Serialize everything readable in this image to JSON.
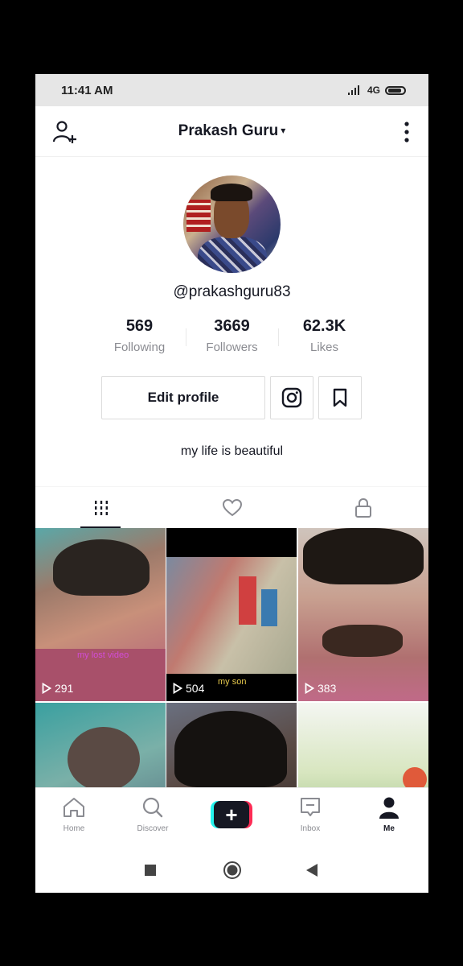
{
  "status_bar": {
    "time": "11:41 AM",
    "network": "4G"
  },
  "header": {
    "title": "Prakash Guru",
    "dropdown_caret": "▾"
  },
  "profile": {
    "username": "@prakashguru83",
    "stats": [
      {
        "value": "569",
        "label": "Following"
      },
      {
        "value": "3669",
        "label": "Followers"
      },
      {
        "value": "62.3K",
        "label": "Likes"
      }
    ],
    "edit_label": "Edit profile",
    "bio": "my life is beautiful"
  },
  "videos": [
    {
      "views": "291",
      "caption": "my lost video"
    },
    {
      "views": "504",
      "caption": "my son"
    },
    {
      "views": "383",
      "caption": ""
    },
    {
      "views": "",
      "caption": ""
    },
    {
      "views": "",
      "caption": ""
    },
    {
      "views": "",
      "caption": ""
    }
  ],
  "bottom_nav": [
    {
      "label": "Home",
      "icon": "home-icon"
    },
    {
      "label": "Discover",
      "icon": "search-icon"
    },
    {
      "label": "+",
      "icon": "create-icon"
    },
    {
      "label": "Inbox",
      "icon": "inbox-icon"
    },
    {
      "label": "Me",
      "icon": "profile-icon"
    }
  ],
  "colors": {
    "accent_cyan": "#25f4ee",
    "accent_red": "#fe2c55",
    "text": "#161823",
    "muted": "#8a8b91"
  }
}
